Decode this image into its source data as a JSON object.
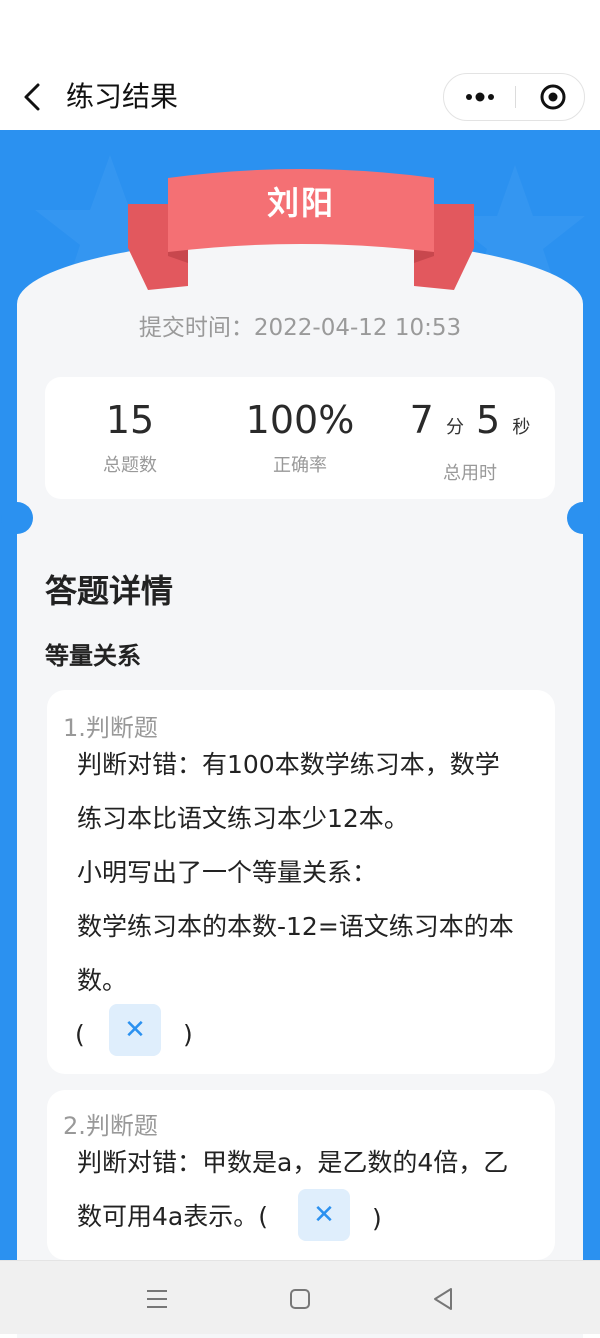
{
  "nav": {
    "title": "练习结果",
    "back_icon": "chevron-left-icon",
    "more_icon": "more-dots-icon",
    "target_icon": "target-icon"
  },
  "ribbon": {
    "name": "刘阳"
  },
  "submit": {
    "label": "提交时间：",
    "value": "2022-04-12 10:53"
  },
  "stats": {
    "total": {
      "value": "15",
      "label": "总题数"
    },
    "accuracy": {
      "value": "100%",
      "label": "正确率"
    },
    "time": {
      "minutes": "7",
      "min_unit": "分",
      "seconds": "5",
      "sec_unit": "秒",
      "label": "总用时"
    }
  },
  "details": {
    "title": "答题详情",
    "section": "等量关系",
    "questions": [
      {
        "type": "1.判断题",
        "lines": [
          "判断对错：有100本数学练习本，数学",
          "练习本比语文练习本少12本。",
          "小明写出了一个等量关系：",
          "数学练习本的本数-12=语文练习本的本",
          "数。"
        ],
        "open": "(",
        "answer": "✕",
        "close": ")"
      },
      {
        "type": "2.判断题",
        "lines": [
          "判断对错：甲数是a，是乙数的4倍，乙",
          "数可用4a表示。("
        ],
        "answer": "✕",
        "close": ")"
      }
    ]
  },
  "colors": {
    "primary": "#2b91f0",
    "ribbon": "#f0696e",
    "card_bg": "#f5f6f8"
  },
  "bottom_nav": {
    "menu_icon": "menu-icon",
    "home_icon": "home-square-icon",
    "back_icon": "back-triangle-icon"
  }
}
